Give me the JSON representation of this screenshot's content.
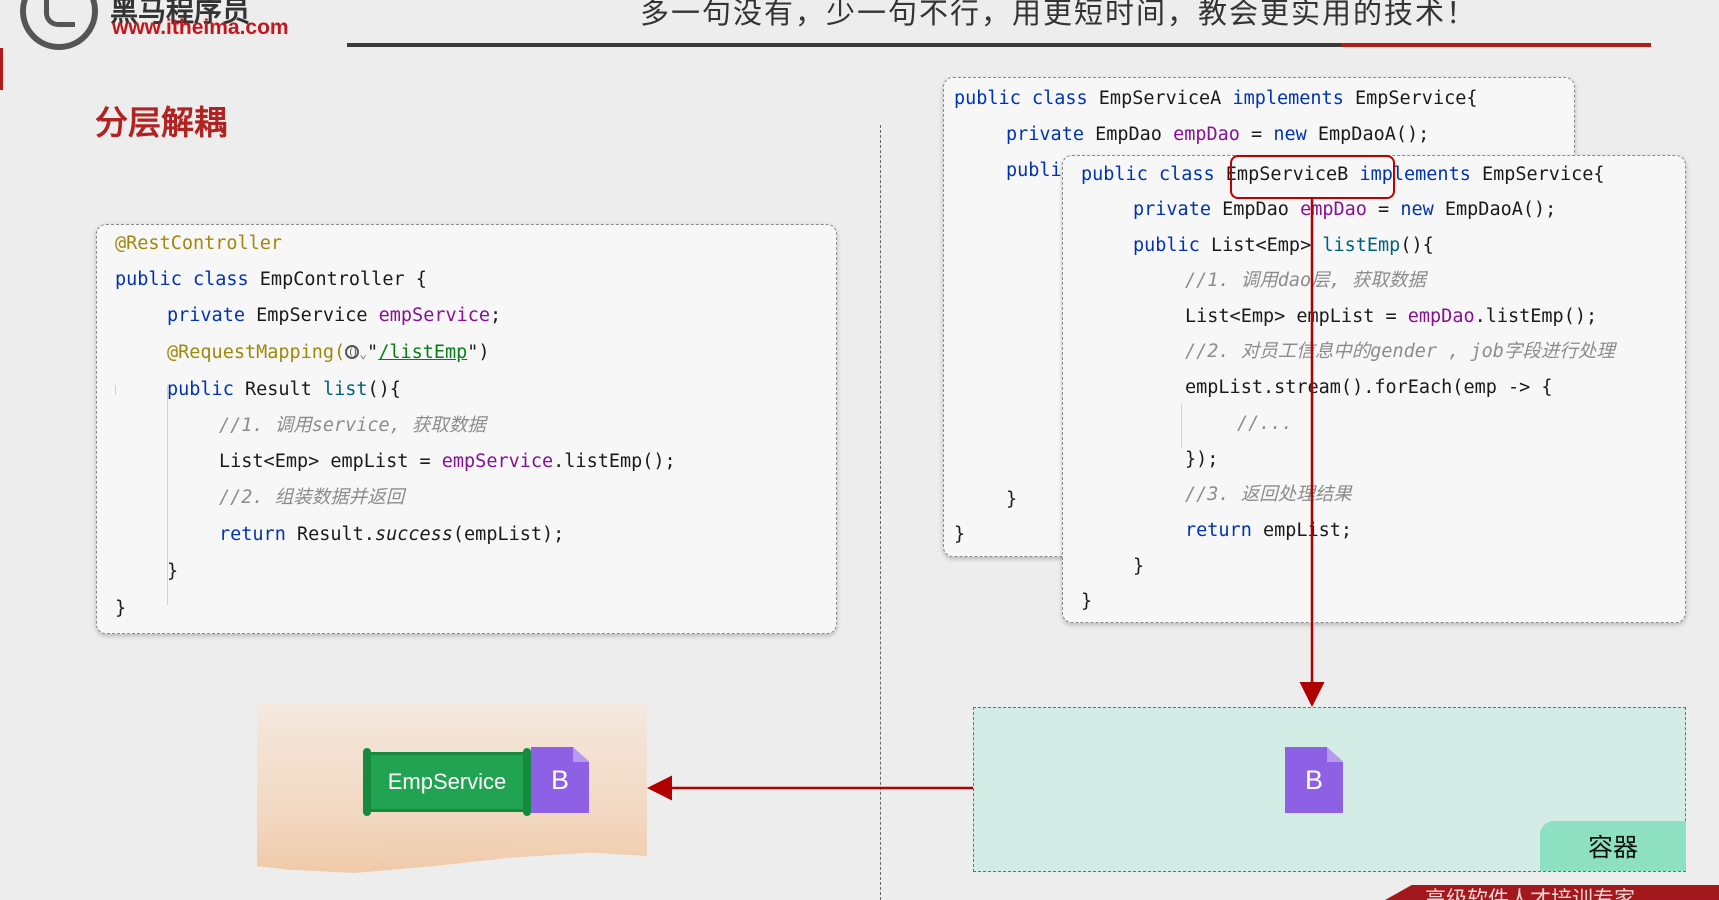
{
  "header": {
    "brand_cn": "黑马程序员",
    "brand_url": "www.itheima.com",
    "slogan": "多一句没有，少一句不行，用更短时间，教会更实用的技术！",
    "brand_color": "#c4161c"
  },
  "section_title": "分层解耦",
  "controller_code": {
    "l1": "@RestController",
    "l2_kw": "public class ",
    "l2_name": "EmpController {",
    "l3_kw": "private ",
    "l3_type": "EmpService ",
    "l3_field": "empService",
    "l3_end": ";",
    "l4_ann": "@RequestMapping(",
    "l4_mid": "\"",
    "l4_str": "/listEmp",
    "l4_end": "\")",
    "l5_kw": "public ",
    "l5_type": "Result ",
    "l5_method": "list",
    "l5_end": "(){",
    "l6": "//1. 调用service, 获取数据",
    "l7_a": "List<Emp> empList = ",
    "l7_field": "empService",
    "l7_end": ".listEmp();",
    "l8": "//2. 组装数据并返回",
    "l9_kw": "return ",
    "l9_a": "Result.",
    "l9_it": "success",
    "l9_end": "(empList);",
    "l10": "}",
    "l11": "}"
  },
  "serviceA_code": {
    "l1_kw": "public class ",
    "l1_name": "EmpServiceA ",
    "l1_kw2": "implements ",
    "l1_end": "EmpService{",
    "l2_kw": "private ",
    "l2_type": "EmpDao ",
    "l2_field": "empDao",
    "l2_eq": " = ",
    "l2_new": "new ",
    "l2_end": "EmpDaoA();",
    "l3_kw": "publi",
    "l4": "}",
    "l5": "}"
  },
  "serviceB_code": {
    "l1_kw": "public class ",
    "l1_name": "EmpServiceB",
    "l1_kw2": " implements ",
    "l1_end": "EmpService{",
    "l2_kw": "private ",
    "l2_type": "EmpDao ",
    "l2_field": "empDao",
    "l2_eq": " = ",
    "l2_new": "new ",
    "l2_end": "EmpDaoA();",
    "l3_kw": "public ",
    "l3_type": "List<Emp> ",
    "l3_method": "listEmp",
    "l3_end": "(){",
    "l4": "//1. 调用dao层, 获取数据",
    "l5_a": "List<Emp> empList = ",
    "l5_field": "empDao",
    "l5_end": ".listEmp();",
    "l6": "//2. 对员工信息中的gender , job字段进行处理",
    "l7": "empList.stream().forEach(emp -> {",
    "l8": "//...",
    "l9": "});",
    "l10": "//3. 返回处理结果",
    "l11_kw": "return ",
    "l11_end": "empList;",
    "l12": "}",
    "l13": "}"
  },
  "diagram": {
    "emp_service_label": "EmpService",
    "bean_label": "B",
    "container_bean_label": "B",
    "container_label": "容器",
    "arrow_color": "#b00000"
  },
  "corner_banner": "高级软件人才培训专家"
}
